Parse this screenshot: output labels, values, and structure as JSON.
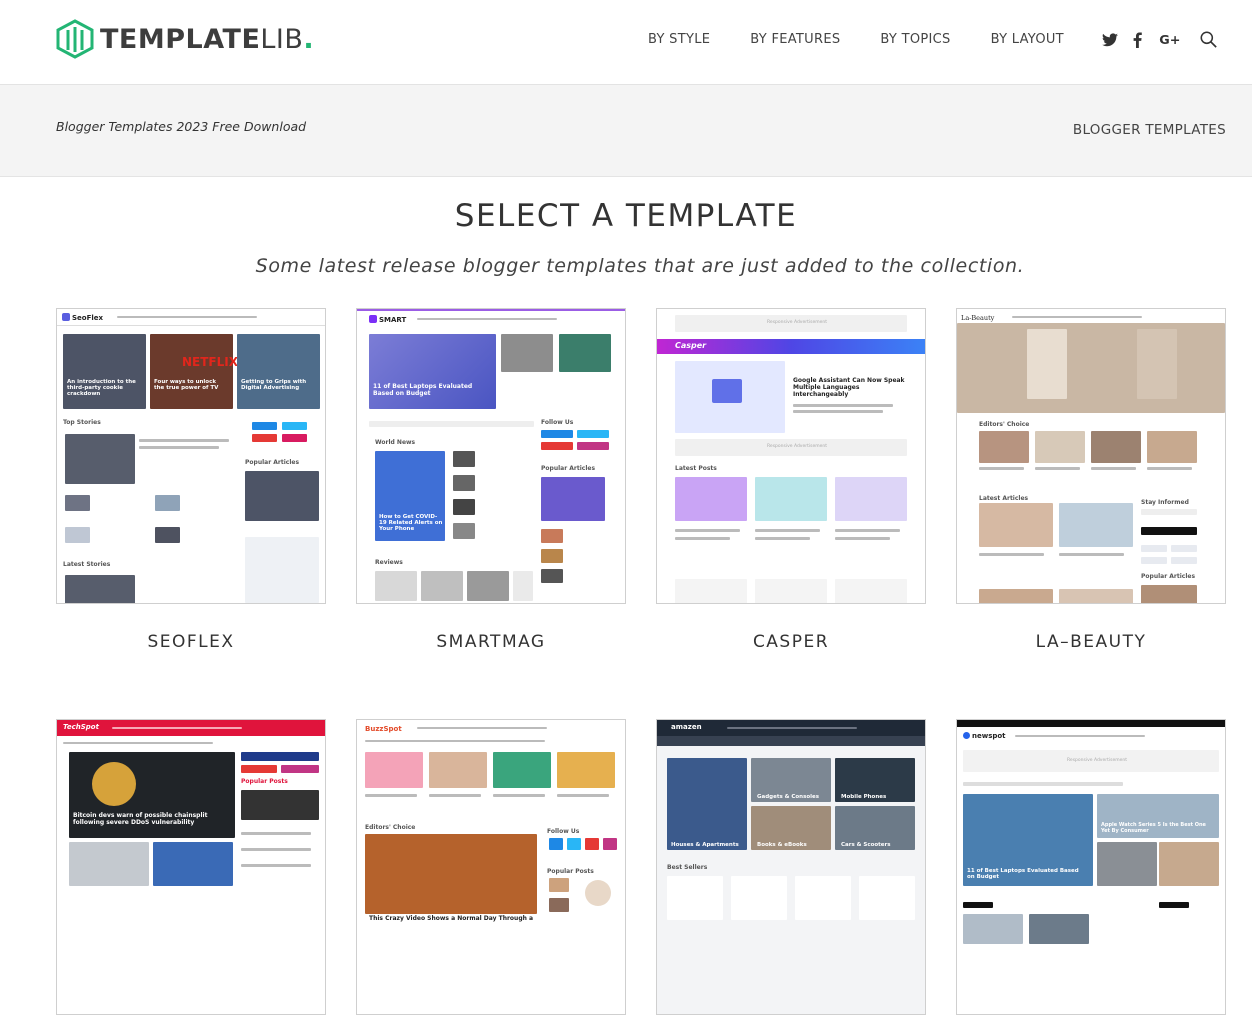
{
  "brand": {
    "logo_bold": "TEMPLATE",
    "logo_light": "LIB",
    "logo_dot": ".",
    "accent": "#23b574"
  },
  "nav": [
    "BY STYLE",
    "BY FEATURES",
    "BY TOPICS",
    "BY LAYOUT"
  ],
  "social": {
    "twitter": "twitter-icon",
    "facebook": "facebook-icon",
    "google": "google-plus-icon",
    "search": "search-icon"
  },
  "breadcrumb": {
    "left": "Blogger Templates 2023 Free Download",
    "right": "BLOGGER TEMPLATES"
  },
  "section": {
    "title": "SELECT A TEMPLATE",
    "subtitle": "Some latest release blogger templates that are just added to the collection."
  },
  "templates": [
    {
      "name": "SEOFLEX",
      "brand": "SeoFlex"
    },
    {
      "name": "SMARTMAG",
      "brand": "SMART"
    },
    {
      "name": "CASPER",
      "brand": "Casper"
    },
    {
      "name": "LA–BEAUTY",
      "brand": "La-Beauty"
    },
    {
      "name": "TECHSPOT",
      "brand": "TechSpot"
    },
    {
      "name": "BUZZSPOT",
      "brand": "BuzzSpot"
    },
    {
      "name": "AMAZEN",
      "brand": "amazen"
    },
    {
      "name": "NEWSPOT",
      "brand": "newspot"
    }
  ],
  "thumb_text": {
    "seoflex_a": "An introduction to the third-party cookie crackdown",
    "seoflex_b": "Four ways to unlock the true power of TV",
    "seoflex_c": "Getting to Grips with Digital Advertising",
    "seoflex_top": "Top Stories",
    "seoflex_pop": "Popular Articles",
    "seoflex_latest": "Latest Stories",
    "smart_a": "11 of Best Laptops Evaluated Based on Budget",
    "smart_b": "How to Get COVID-19 Related Alerts on Your Phone",
    "smart_world": "World News",
    "smart_follow": "Follow Us",
    "smart_pop": "Popular Articles",
    "smart_reviews": "Reviews",
    "casper_a": "Google Assistant Can Now Speak Multiple Languages Interchangeably",
    "casper_latest": "Latest Posts",
    "casper_ad": "Responsive Advertisement",
    "beauty_editors": "Editors' Choice",
    "beauty_latest": "Latest Articles",
    "beauty_stay": "Stay Informed",
    "beauty_pop": "Popular Articles",
    "tech_a": "Bitcoin devs warn of possible chainsplit following severe DDoS vulnerability",
    "tech_pop": "Popular Posts",
    "buzz_a": "This Crazy Video Shows a Normal Day Through a",
    "buzz_editors": "Editors' Choice",
    "buzz_follow": "Follow Us",
    "buzz_pop": "Popular Posts",
    "amazen_a": "Gadgets & Consoles",
    "amazen_b": "Mobile Phones",
    "amazen_c": "Houses & Apartments",
    "amazen_d": "Books & eBooks",
    "amazen_e": "Cars & Scooters",
    "amazen_best": "Best Sellers",
    "newspot_a": "11 of Best Laptops Evaluated Based on Budget",
    "newspot_ad": "Responsive Advertisement",
    "newspot_b": "Apple Watch Series 5 Is the Best One Yet By Consumer"
  }
}
